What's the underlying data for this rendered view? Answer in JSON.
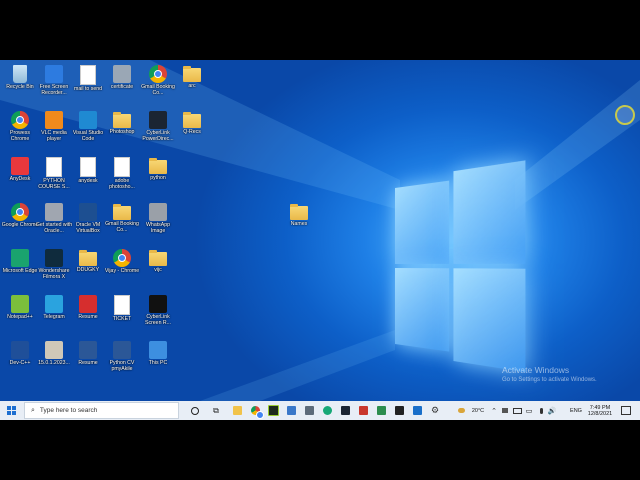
{
  "desktop": {
    "icons": [
      {
        "label": "Recycle Bin",
        "icon": "recycle-bin-icon",
        "kind": "bin"
      },
      {
        "label": "Free Screen Recorder...",
        "icon": "screen-recorder-icon",
        "kind": "app",
        "color": "#2d7be0"
      },
      {
        "label": "mail to send",
        "icon": "document-icon",
        "kind": "doc"
      },
      {
        "label": "certificate",
        "icon": "archive-icon",
        "kind": "app",
        "color": "#9aa7b5"
      },
      {
        "label": "Gmail Booking Co...",
        "icon": "chrome-icon",
        "kind": "chrome"
      },
      {
        "label": "arc",
        "icon": "folder-icon",
        "kind": "folder"
      },
      {
        "label": "Prowess Chrome",
        "icon": "chrome-icon",
        "kind": "chrome"
      },
      {
        "label": "VLC media player",
        "icon": "vlc-icon",
        "kind": "app",
        "color": "#f08a1c"
      },
      {
        "label": "Visual Studio Code",
        "icon": "vscode-icon",
        "kind": "app",
        "color": "#1f8ad2"
      },
      {
        "label": "Photoshop",
        "icon": "folder-icon",
        "kind": "folder"
      },
      {
        "label": "CyberLink PowerDirec...",
        "icon": "powerdirector-icon",
        "kind": "app",
        "color": "#1b2533"
      },
      {
        "label": "Q-Recs",
        "icon": "folder-icon",
        "kind": "folder"
      },
      {
        "label": "AnyDesk",
        "icon": "anydesk-icon",
        "kind": "app",
        "color": "#e8383d"
      },
      {
        "label": "PYTHON COURSE S...",
        "icon": "document-icon",
        "kind": "doc"
      },
      {
        "label": "anydesk",
        "icon": "document-icon",
        "kind": "doc"
      },
      {
        "label": "adobe photosho...",
        "icon": "document-icon",
        "kind": "doc"
      },
      {
        "label": "python",
        "icon": "folder-icon",
        "kind": "folder"
      },
      {
        "label": "Google Chrome",
        "icon": "chrome-icon",
        "kind": "chrome"
      },
      {
        "label": "Get started with Oracle...",
        "icon": "oracle-icon",
        "kind": "app",
        "color": "#a0a6b0"
      },
      {
        "label": "Oracle VM VirtualBox",
        "icon": "virtualbox-icon",
        "kind": "app",
        "color": "#1d4f91"
      },
      {
        "label": "Gmail Booking Co...",
        "icon": "folder-icon",
        "kind": "folder"
      },
      {
        "label": "WhatsApp Image",
        "icon": "image-icon",
        "kind": "app",
        "color": "#9aa0a8"
      },
      {
        "label": "Names",
        "icon": "folder-icon",
        "kind": "folder"
      },
      {
        "label": "Microsoft Edge",
        "icon": "edge-icon",
        "kind": "app",
        "color": "#1aa36e"
      },
      {
        "label": "Wondershare Filmora X",
        "icon": "filmora-icon",
        "kind": "app",
        "color": "#0f2b3d"
      },
      {
        "label": "DDUGKY",
        "icon": "folder-icon",
        "kind": "folder"
      },
      {
        "label": "Vijay - Chrome",
        "icon": "chrome-icon",
        "kind": "chrome"
      },
      {
        "label": "vijc",
        "icon": "folder-icon",
        "kind": "folder"
      },
      {
        "label": "Notepad++",
        "icon": "notepad-icon",
        "kind": "app",
        "color": "#7bbf3c"
      },
      {
        "label": "Telegram",
        "icon": "telegram-icon",
        "kind": "app",
        "color": "#2aa3df"
      },
      {
        "label": "Resume",
        "icon": "pdf-icon",
        "kind": "app",
        "color": "#d62e2e"
      },
      {
        "label": "TICKET",
        "icon": "document-icon",
        "kind": "doc"
      },
      {
        "label": "CyberLink Screen R...",
        "icon": "screen-recorder-icon",
        "kind": "app",
        "color": "#111111"
      },
      {
        "label": "Dev-C++",
        "icon": "devcpp-icon",
        "kind": "app",
        "color": "#1f4f99"
      },
      {
        "label": "15.0.1.2023...",
        "icon": "archive-icon",
        "kind": "app",
        "color": "#cfc8b8"
      },
      {
        "label": "Resume",
        "icon": "word-icon",
        "kind": "app",
        "color": "#2b5797"
      },
      {
        "label": "Python CV pmyAkile",
        "icon": "word-icon",
        "kind": "app",
        "color": "#2b5797"
      },
      {
        "label": "This PC",
        "icon": "this-pc-icon",
        "kind": "app",
        "color": "#3d8fe0"
      }
    ]
  },
  "watermark": {
    "title": "Activate Windows",
    "subtitle": "Go to Settings to activate Windows."
  },
  "taskbar": {
    "search_placeholder": "Type here to search",
    "weather": "20°C",
    "language": "ENG",
    "time": "7:49 PM",
    "date": "12/8/2021"
  }
}
